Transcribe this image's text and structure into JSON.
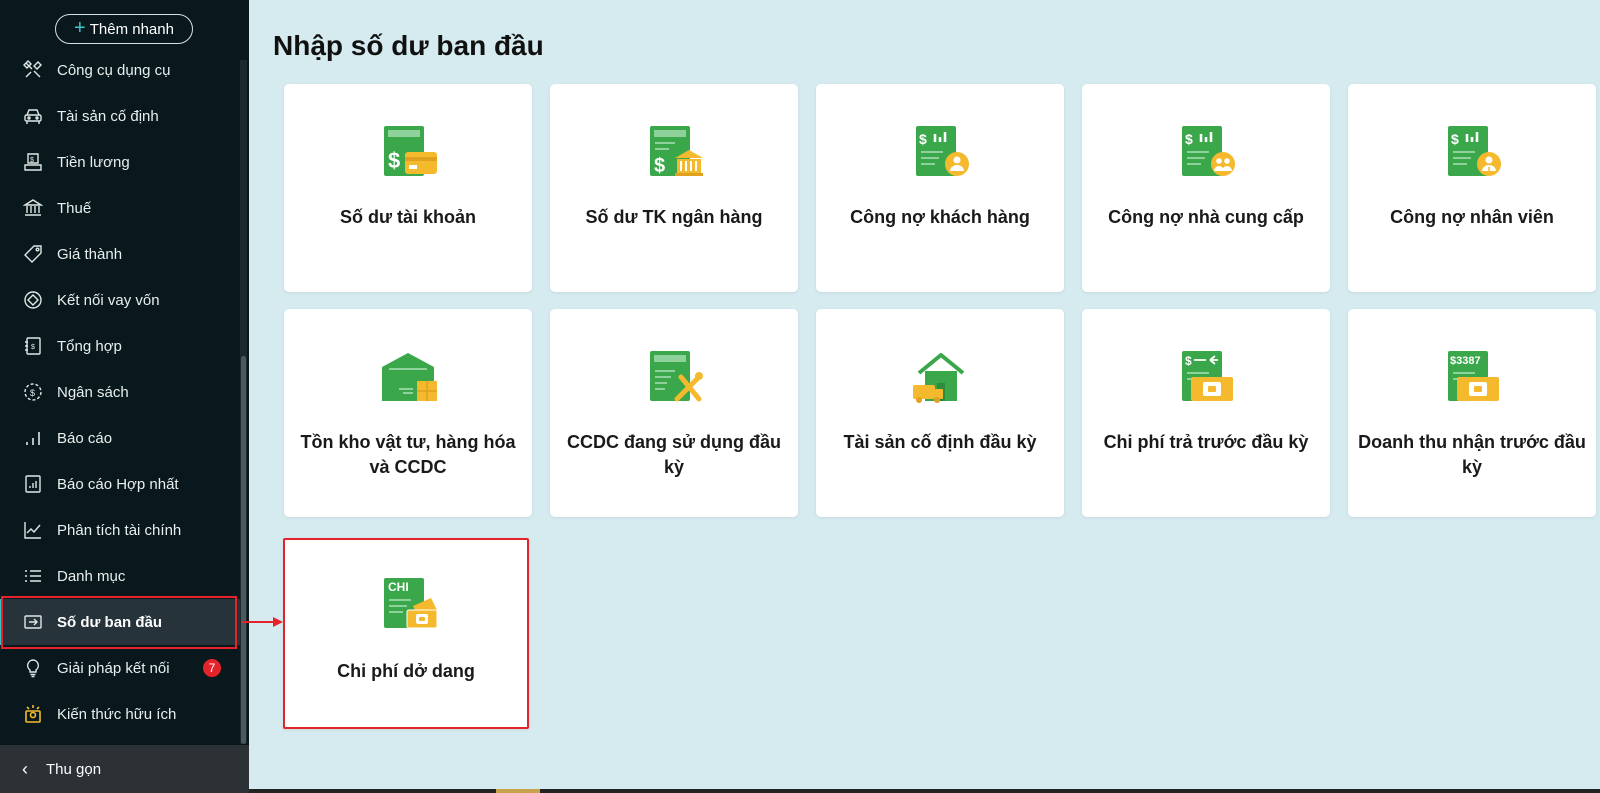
{
  "sidebar": {
    "quick_add_label": "Thêm nhanh",
    "items": [
      {
        "label": "Công cụ dụng cụ",
        "icon": "tools-icon"
      },
      {
        "label": "Tài sản cố định",
        "icon": "car-icon"
      },
      {
        "label": "Tiền lương",
        "icon": "salary-icon"
      },
      {
        "label": "Thuế",
        "icon": "bank-icon"
      },
      {
        "label": "Giá thành",
        "icon": "tag-icon"
      },
      {
        "label": "Kết nối vay vốn",
        "icon": "loan-icon"
      },
      {
        "label": "Tổng hợp",
        "icon": "ledger-icon"
      },
      {
        "label": "Ngân sách",
        "icon": "budget-icon"
      },
      {
        "label": "Báo cáo",
        "icon": "bar-chart-icon"
      },
      {
        "label": "Báo cáo Hợp nhất",
        "icon": "report-icon"
      },
      {
        "label": "Phân tích tài chính",
        "icon": "analysis-icon"
      },
      {
        "label": "Danh mục",
        "icon": "list-icon"
      },
      {
        "label": "Số dư ban đầu",
        "icon": "import-icon",
        "active": true
      },
      {
        "label": "Giải pháp kết nối",
        "icon": "bulb-icon",
        "badge": "7"
      },
      {
        "label": "Kiến thức hữu ích",
        "icon": "knowledge-icon"
      }
    ],
    "collapse_label": "Thu gọn"
  },
  "main": {
    "title": "Nhập số dư ban đầu",
    "cards": [
      {
        "title": "Số dư tài khoản",
        "icon": "account-balance-icon"
      },
      {
        "title": "Số dư TK ngân hàng",
        "icon": "bank-balance-icon"
      },
      {
        "title": "Công nợ khách hàng",
        "icon": "customer-debt-icon"
      },
      {
        "title": "Công nợ nhà cung cấp",
        "icon": "supplier-debt-icon"
      },
      {
        "title": "Công nợ nhân viên",
        "icon": "employee-debt-icon"
      },
      {
        "title": "Tồn kho vật tư, hàng hóa và CCDC",
        "icon": "inventory-icon"
      },
      {
        "title": "CCDC đang sử dụng đầu kỳ",
        "icon": "tools-in-use-icon"
      },
      {
        "title": "Tài sản cố định đầu kỳ",
        "icon": "fixed-asset-icon"
      },
      {
        "title": "Chi phí trả trước đầu kỳ",
        "icon": "prepaid-expense-icon"
      },
      {
        "title": "Doanh thu nhận trước đầu kỳ",
        "icon": "unearned-revenue-icon",
        "icon_text": "$3387"
      },
      {
        "title": "Chi phí dở dang",
        "icon": "wip-cost-icon",
        "icon_text": "CHI",
        "selected": true
      }
    ]
  },
  "colors": {
    "sidebar_bg": "#08181c",
    "main_bg": "#d5ebef",
    "accent": "#3ec3c9",
    "icon_green": "#3aa84a",
    "icon_yellow": "#f5b92e",
    "highlight_red": "#e5232b"
  }
}
